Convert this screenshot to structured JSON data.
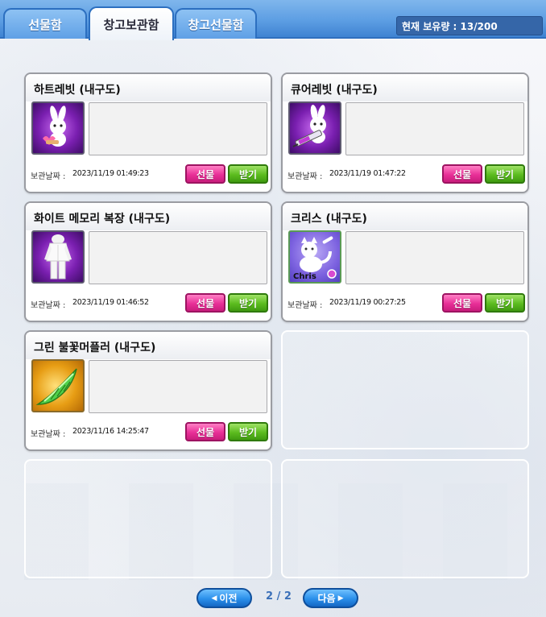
{
  "tabs": [
    {
      "label": "선물함",
      "active": false
    },
    {
      "label": "창고보관함",
      "active": true
    },
    {
      "label": "창고선물함",
      "active": false
    }
  ],
  "holding": "현재 보유량 : 13/200",
  "date_label": "보관날짜 :",
  "items": [
    {
      "title": "하트레빗 (내구도)",
      "date": "2023/11/19 01:49:23",
      "gift_label": "선물",
      "receive_label": "받기",
      "icon": "bunny-heart-icon"
    },
    {
      "title": "큐어레빗 (내구도)",
      "date": "2023/11/19 01:47:22",
      "gift_label": "선물",
      "receive_label": "받기",
      "icon": "bunny-syringe-icon"
    },
    {
      "title": "화이트 메모리 복장 (내구도)",
      "date": "2023/11/19 01:46:52",
      "gift_label": "선물",
      "receive_label": "받기",
      "icon": "white-outfit-icon"
    },
    {
      "title": "크리스 (내구도)",
      "date": "2023/11/19 00:27:25",
      "gift_label": "선물",
      "receive_label": "받기",
      "icon": "chris-pet-icon",
      "icon_text": "Chris"
    },
    {
      "title": "그린 불꽃머플러 (내구도)",
      "date": "2023/11/16 14:25:47",
      "gift_label": "선물",
      "receive_label": "받기",
      "icon": "green-wing-icon"
    }
  ],
  "pagination": {
    "prev_label": "이전",
    "next_label": "다음",
    "page": "2 / 2"
  },
  "colors": {
    "gift_button": "#e82f97",
    "receive_button": "#5cbc1f",
    "tab_bar": "#5d9ee3"
  }
}
